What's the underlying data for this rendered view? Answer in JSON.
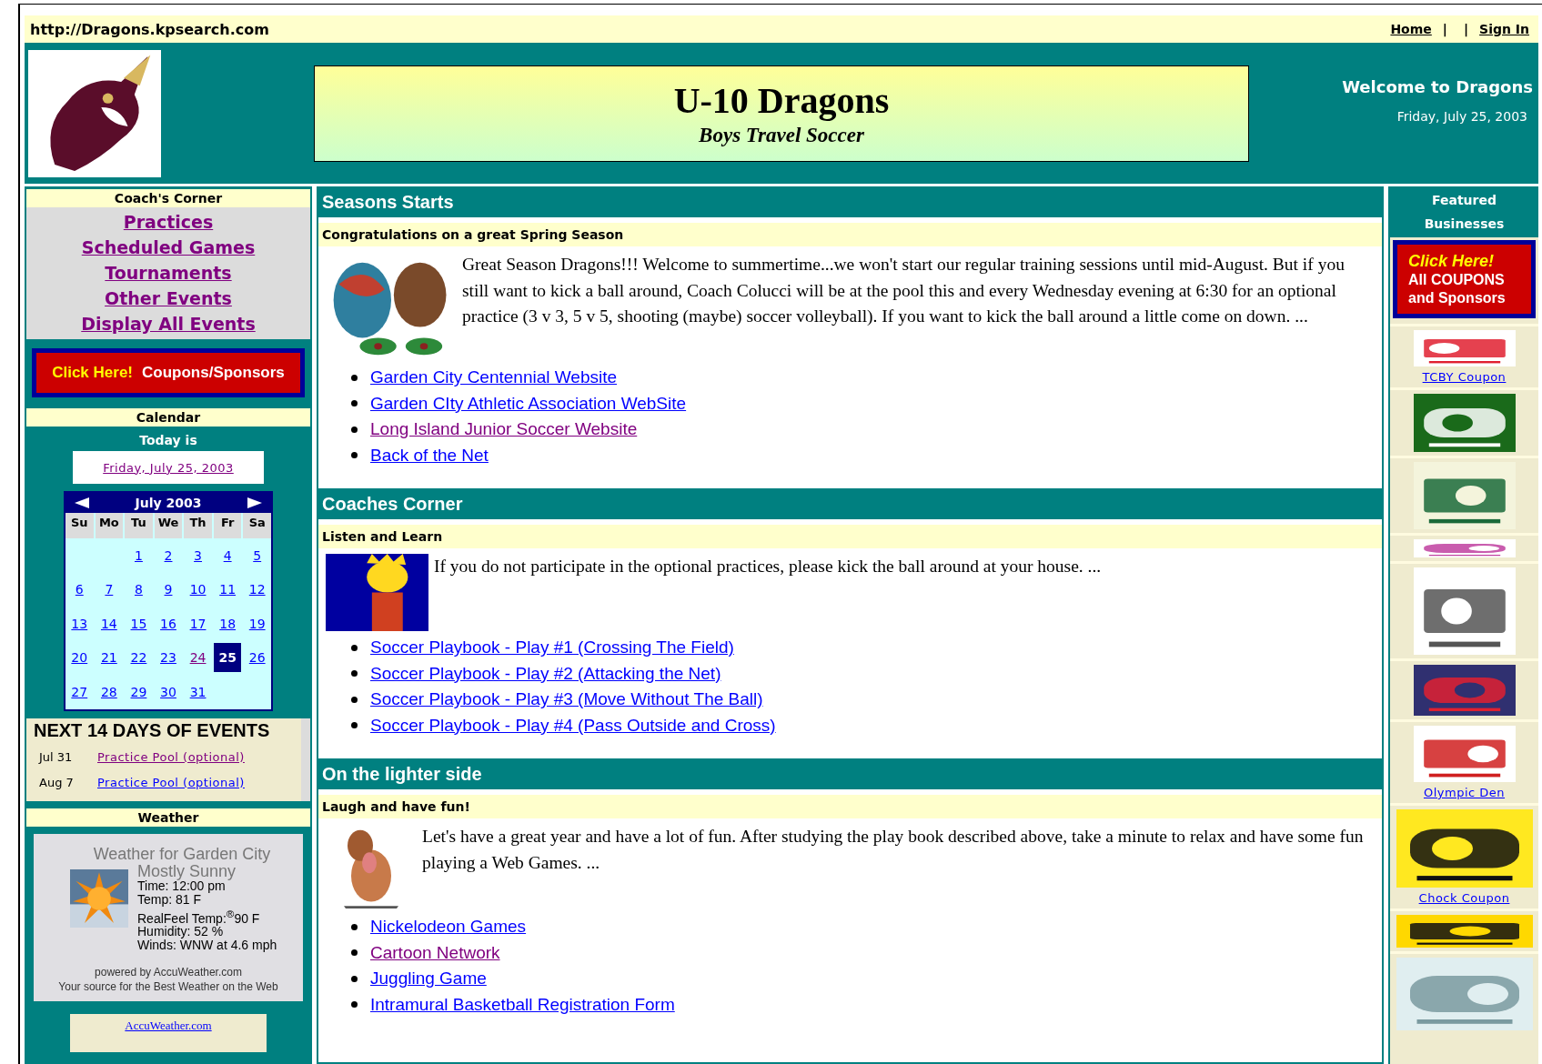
{
  "top_bar": {
    "url": "http://Dragons.kpsearch.com",
    "nav": [
      {
        "kind": "link",
        "text": "Home"
      },
      {
        "kind": "separator",
        "text": "|"
      },
      {
        "kind": "separator",
        "text": "|"
      },
      {
        "kind": "link",
        "text": "Sign In"
      }
    ]
  },
  "header": {
    "title": "U-10 Dragons",
    "subtitle": "Boys Travel Soccer",
    "welcome": "Welcome to Dragons",
    "date": "Friday, July 25, 2003"
  },
  "coachs_corner": {
    "title": "Coach's Corner",
    "links": [
      {
        "label": "Practices",
        "visited": true
      },
      {
        "label": "Scheduled Games",
        "visited": true
      },
      {
        "label": "Tournaments",
        "visited": true
      },
      {
        "label": "Other Events",
        "visited": true
      },
      {
        "label": "Display All Events",
        "visited": true
      }
    ]
  },
  "coupon_button": {
    "highlight": "Click Here!",
    "label": "Coupons/Sponsors"
  },
  "calendar": {
    "title": "Calendar",
    "today_label": "Today is",
    "today": "Friday, July 25, 2003",
    "month": "July 2003",
    "weekdays": [
      "Su",
      "Mo",
      "Tu",
      "We",
      "Th",
      "Fr",
      "Sa"
    ],
    "weeks": [
      [
        {
          "day": "1",
          "visited": false,
          "selected": false
        },
        {
          "day": "2",
          "visited": false,
          "selected": false
        },
        {
          "day": "3",
          "visited": false,
          "selected": false
        },
        {
          "day": "4",
          "visited": false,
          "selected": false
        },
        {
          "day": "5",
          "visited": false,
          "selected": false
        }
      ],
      [
        {
          "day": "6",
          "visited": false,
          "selected": false
        },
        {
          "day": "7",
          "visited": false,
          "selected": false
        },
        {
          "day": "8",
          "visited": false,
          "selected": false
        },
        {
          "day": "9",
          "visited": false,
          "selected": false
        },
        {
          "day": "10",
          "visited": false,
          "selected": false
        },
        {
          "day": "11",
          "visited": false,
          "selected": false
        },
        {
          "day": "12",
          "visited": false,
          "selected": false
        }
      ],
      [
        {
          "day": "13",
          "visited": false,
          "selected": false
        },
        {
          "day": "14",
          "visited": false,
          "selected": false
        },
        {
          "day": "15",
          "visited": false,
          "selected": false
        },
        {
          "day": "16",
          "visited": false,
          "selected": false
        },
        {
          "day": "17",
          "visited": false,
          "selected": false
        },
        {
          "day": "18",
          "visited": false,
          "selected": false
        },
        {
          "day": "19",
          "visited": false,
          "selected": false
        }
      ],
      [
        {
          "day": "20",
          "visited": false,
          "selected": false
        },
        {
          "day": "21",
          "visited": false,
          "selected": false
        },
        {
          "day": "22",
          "visited": false,
          "selected": false
        },
        {
          "day": "23",
          "visited": false,
          "selected": false
        },
        {
          "day": "24",
          "visited": true,
          "selected": false
        },
        {
          "day": "25",
          "visited": false,
          "selected": true
        },
        {
          "day": "26",
          "visited": false,
          "selected": false
        }
      ],
      [
        {
          "day": "27",
          "visited": false,
          "selected": false
        },
        {
          "day": "28",
          "visited": false,
          "selected": false
        },
        {
          "day": "29",
          "visited": false,
          "selected": false
        },
        {
          "day": "30",
          "visited": false,
          "selected": false
        },
        {
          "day": "31",
          "visited": false,
          "selected": false
        }
      ]
    ]
  },
  "events": {
    "title": "NEXT 14 DAYS OF EVENTS",
    "items": [
      {
        "date": "Jul 31",
        "label": "Practice Pool (optional)",
        "visited": true
      },
      {
        "date": "Aug 7",
        "label": "Practice Pool (optional)",
        "visited": false
      }
    ]
  },
  "weather": {
    "title": "Weather",
    "heading": "Weather for Garden City",
    "condition": "Mostly Sunny",
    "details": [
      "Time: 12:00 pm",
      "Temp: 81 F",
      "RealFeel Temp:$^{®}$90 F",
      "Humidity: 52 %",
      "Winds: WNW at 4.6 mph"
    ],
    "powered_by": "powered by AccuWeather.com",
    "tagline": "Your source for the Best Weather on the Web",
    "forecast_link": "AccuWeather.com"
  },
  "sections": [
    {
      "title": "Seasons Starts",
      "subtitle": "Congratulations on a great Spring Season",
      "text": "Great Season Dragons!!! Welcome to summertime...we won't start our regular training sessions until mid-August. But if you still want to kick a ball around, Coach Colucci will be at the pool this and every Wednesday evening at 6:30 for an optional practice (3 v 3, 5 v 5, shooting (maybe) soccer volleyball). If you want to kick the ball around a little come on down. ...",
      "links": [
        {
          "label": "Garden City Centennial Website",
          "visited": false
        },
        {
          "label": "Garden CIty Athletic Association WebSite",
          "visited": false
        },
        {
          "label": "Long Island Junior Soccer Website",
          "visited": true
        },
        {
          "label": "Back of the Net",
          "visited": false
        }
      ]
    },
    {
      "title": "Coaches Corner",
      "subtitle": "Listen and Learn",
      "text": "If you do not participate in the optional practices, please kick the ball around at your house. ...",
      "links": [
        {
          "label": "Soccer Playbook - Play #1 (Crossing The Field)",
          "visited": false
        },
        {
          "label": "Soccer Playbook - Play #2 (Attacking the Net)",
          "visited": false
        },
        {
          "label": "Soccer Playbook - Play #3 (Move Without The Ball)",
          "visited": false
        },
        {
          "label": "Soccer Playbook - Play #4 (Pass Outside and Cross)",
          "visited": false
        }
      ]
    },
    {
      "title": "On the lighter side",
      "subtitle": "Laugh and have fun!",
      "text": "Let's have a great year and have a lot of fun. After studying the play book described above, take a minute to relax and have some fun playing a Web Games. ...",
      "links": [
        {
          "label": "Nickelodeon Games",
          "visited": false
        },
        {
          "label": "Cartoon Network",
          "visited": true
        },
        {
          "label": "Juggling Game",
          "visited": false
        },
        {
          "label": "Intramural Basketball Registration Form",
          "visited": false
        }
      ]
    }
  ],
  "featured": {
    "title": "Featured Businesses",
    "banner": {
      "highlight": "Click Here!",
      "lines": [
        "All COUPONS",
        "and Sponsors"
      ]
    },
    "sponsors": [
      {
        "kind": "picture",
        "caption": "TCBY Coupon"
      },
      {
        "kind": "picture"
      },
      {
        "kind": "picture"
      },
      {
        "kind": "picture"
      },
      {
        "kind": "picture"
      },
      {
        "kind": "picture"
      },
      {
        "kind": "picture",
        "caption": "Olympic Den"
      },
      {
        "kind": "picture",
        "caption": "Chock Coupon"
      },
      {
        "kind": "picture"
      },
      {
        "kind": "picture"
      }
    ]
  }
}
